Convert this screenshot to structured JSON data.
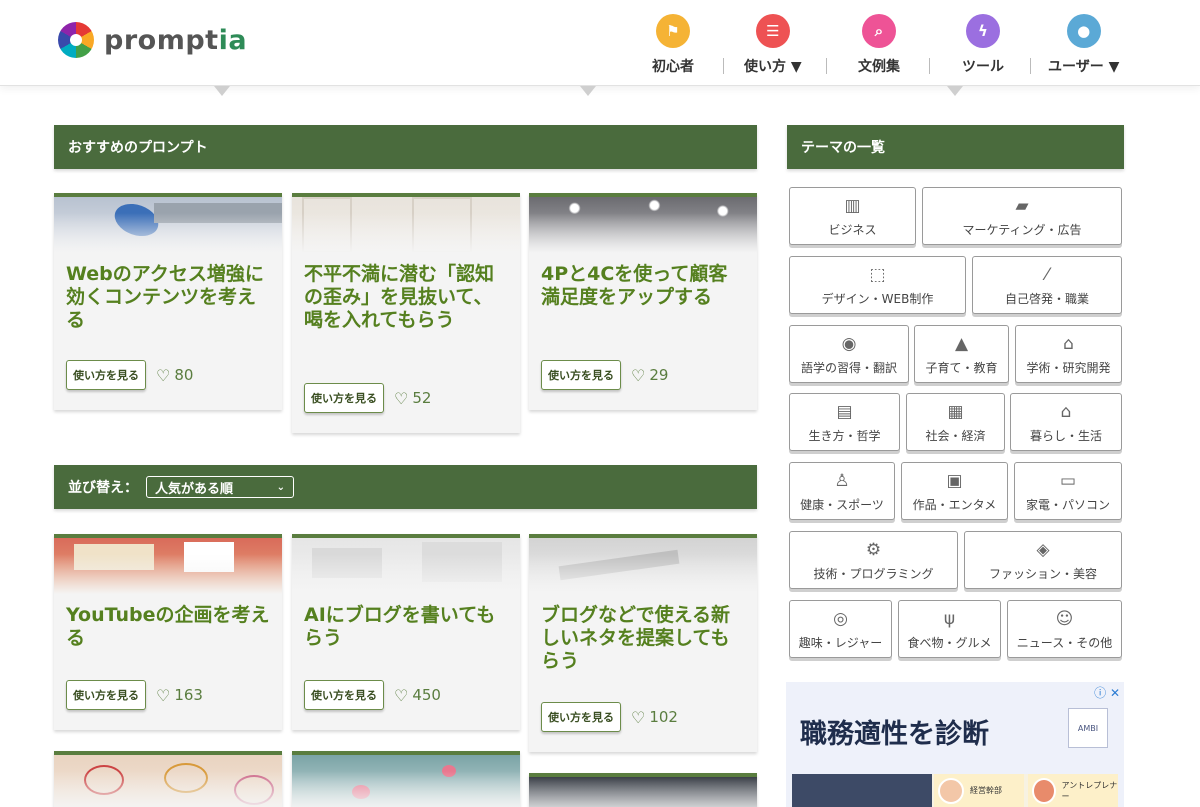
{
  "logo": {
    "text_main": "prompt",
    "text_accent": "ia"
  },
  "nav": [
    {
      "label": "初心者",
      "icon": "flag-icon",
      "glyph": "⚑",
      "color": "#f5b335"
    },
    {
      "label": "使い方 ▼",
      "icon": "list-icon",
      "glyph": "☰",
      "color": "#ee5253"
    },
    {
      "label": "文例集",
      "icon": "search-icon",
      "glyph": "⌕",
      "color": "#ee5396"
    },
    {
      "label": "ツール",
      "icon": "lightning-icon",
      "glyph": "ϟ",
      "color": "#9b6fe0"
    },
    {
      "label": "ユーザー ▼",
      "icon": "user-icon",
      "glyph": "●",
      "color": "#5ba9d6"
    }
  ],
  "recommended": {
    "header": "おすすめのプロンプト",
    "cards": [
      {
        "title": "Webのアクセス増強に効くコンテンツを考える",
        "button": "使い方を見る",
        "likes": "80"
      },
      {
        "title": "不平不満に潜む「認知の歪み」を見抜いて、喝を入れてもらう",
        "button": "使い方を見る",
        "likes": "52"
      },
      {
        "title": "4Pと4Cを使って顧客満足度をアップする",
        "button": "使い方を見る",
        "likes": "29"
      }
    ]
  },
  "sort": {
    "label": "並び替え：",
    "selected": "人気がある順"
  },
  "list": {
    "cards": [
      {
        "title": "YouTubeの企画を考える",
        "button": "使い方を見る",
        "likes": "163"
      },
      {
        "title": "AIにブログを書いてもらう",
        "button": "使い方を見る",
        "likes": "450"
      },
      {
        "title": "ブログなどで使える新しいネタを提案してもらう",
        "button": "使い方を見る",
        "likes": "102"
      }
    ]
  },
  "themes": {
    "header": "テーマの一覧",
    "items": [
      {
        "label": "ビジネス",
        "icon": "building-icon",
        "glyph": "▥"
      },
      {
        "label": "マーケティング・広告",
        "icon": "shopping-bag-icon",
        "glyph": "👜"
      },
      {
        "label": "デザイン・WEB制作",
        "icon": "vector-icon",
        "glyph": "⬚"
      },
      {
        "label": "自己啓発・職業",
        "icon": "magic-wand-icon",
        "glyph": "⚡"
      },
      {
        "label": "語学の習得・翻訳",
        "icon": "globe-icon",
        "glyph": "◉"
      },
      {
        "label": "子育て・教育",
        "icon": "graduation-cap-icon",
        "glyph": "▲"
      },
      {
        "label": "学術・研究開発",
        "icon": "institution-icon",
        "glyph": "⌂"
      },
      {
        "label": "生き方・哲学",
        "icon": "book-icon",
        "glyph": "▤"
      },
      {
        "label": "社会・経済",
        "icon": "newspaper-icon",
        "glyph": "▦"
      },
      {
        "label": "暮らし・生活",
        "icon": "home-icon",
        "glyph": "⌂"
      },
      {
        "label": "健康・スポーツ",
        "icon": "person-icon",
        "glyph": "♙"
      },
      {
        "label": "作品・エンタメ",
        "icon": "film-icon",
        "glyph": "▣"
      },
      {
        "label": "家電・パソコン",
        "icon": "monitor-icon",
        "glyph": "▭"
      },
      {
        "label": "技術・プログラミング",
        "icon": "gear-icon",
        "glyph": "⚙"
      },
      {
        "label": "ファッション・美容",
        "icon": "cosmetics-icon",
        "glyph": "◈"
      },
      {
        "label": "趣味・レジャー",
        "icon": "compass-icon",
        "glyph": "◎"
      },
      {
        "label": "食べ物・グルメ",
        "icon": "utensils-icon",
        "glyph": "ψ"
      },
      {
        "label": "ニュース・その他",
        "icon": "smile-icon",
        "glyph": "☺"
      }
    ]
  },
  "ad": {
    "title": "職務適性を診断",
    "logo_text": "AMBI",
    "chips": [
      "経営幹部",
      "アントレプレナー"
    ],
    "badge": "ⓘ ✕"
  },
  "colors": {
    "section_bar": "#4a6b3d",
    "card_title": "#55801f",
    "card_top_border": "#5a7d3f"
  }
}
